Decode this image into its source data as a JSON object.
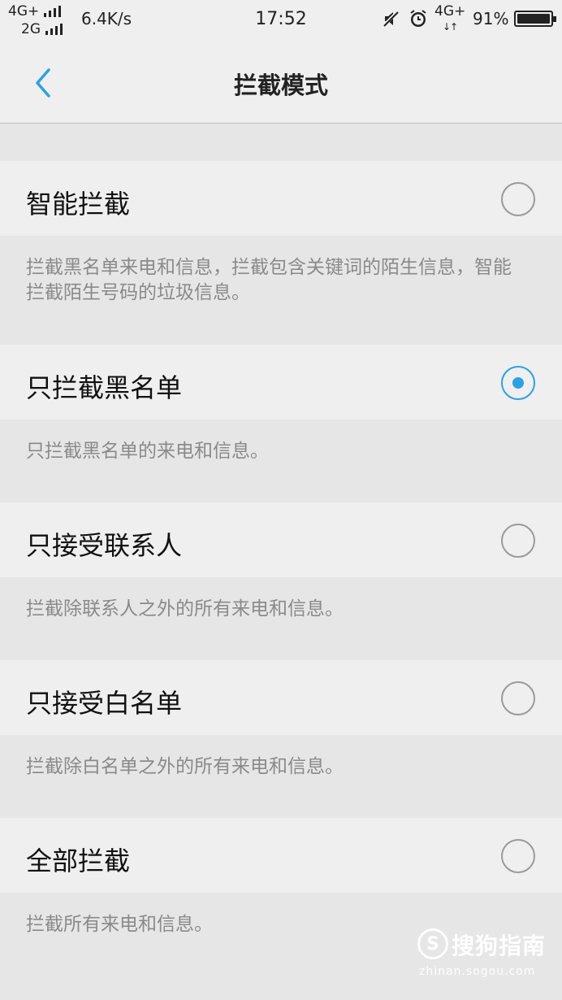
{
  "status_bar": {
    "network_primary": "4G+",
    "network_secondary": "2G",
    "speed": "6.4K/s",
    "time": "17:52",
    "network_right": "4G+",
    "battery": "91%",
    "icons": [
      "signal-icon",
      "mute-icon",
      "alarm-icon",
      "battery-icon"
    ]
  },
  "header": {
    "title": "拦截模式",
    "back_icon": "chevron-left-icon",
    "accent_color": "#2aa2e6"
  },
  "options": [
    {
      "label": "智能拦截",
      "description": "拦截黑名单来电和信息，拦截包含关键词的陌生信息，智能拦截陌生号码的垃圾信息。",
      "selected": false
    },
    {
      "label": "只拦截黑名单",
      "description": "只拦截黑名单的来电和信息。",
      "selected": true
    },
    {
      "label": "只接受联系人",
      "description": "拦截除联系人之外的所有来电和信息。",
      "selected": false
    },
    {
      "label": "只接受白名单",
      "description": "拦截除白名单之外的所有来电和信息。",
      "selected": false
    },
    {
      "label": "全部拦截",
      "description": "拦截所有来电和信息。",
      "selected": false
    }
  ],
  "watermark": {
    "logo": "S",
    "text": "搜狗指南",
    "url": "zhinan.sogou.com"
  }
}
